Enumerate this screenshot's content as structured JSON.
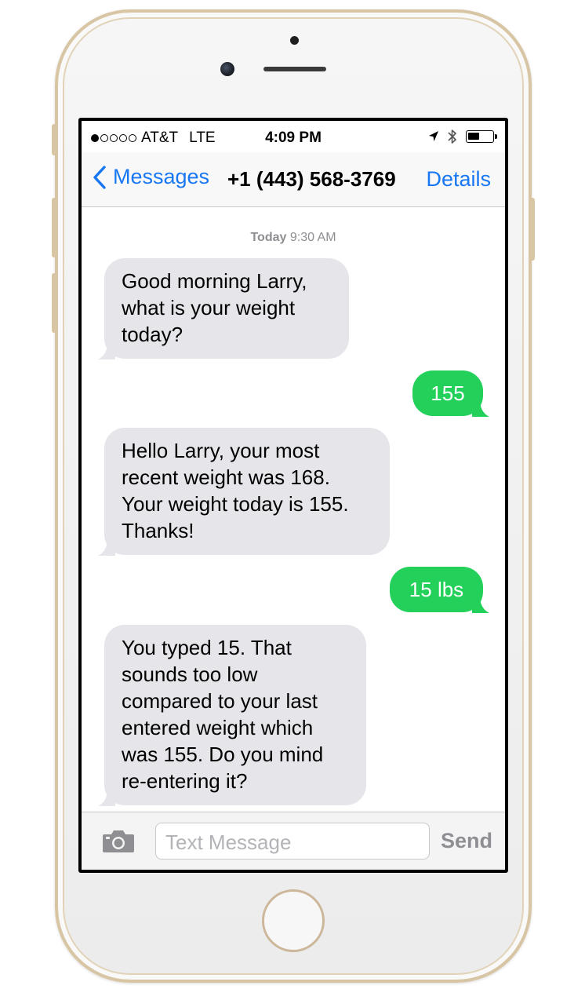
{
  "status_bar": {
    "signal_filled": 1,
    "signal_total": 5,
    "carrier": "AT&T",
    "network": "LTE",
    "time": "4:09 PM",
    "battery_level": 0.45
  },
  "nav": {
    "back_label": "Messages",
    "title": "+1 (443) 568-3769",
    "details_label": "Details"
  },
  "conversation": {
    "timestamp_day": "Today",
    "timestamp_time": "9:30 AM",
    "messages": [
      {
        "direction": "incoming",
        "lines": [
          "Good morning Larry,",
          "what is your weight",
          "today?"
        ]
      },
      {
        "direction": "outgoing",
        "lines": [
          "155"
        ]
      },
      {
        "direction": "incoming",
        "lines": [
          "Hello Larry, your most",
          "recent weight was 168.",
          "Your weight today is 155.",
          "Thanks!"
        ]
      },
      {
        "direction": "outgoing",
        "lines": [
          "15 lbs"
        ]
      },
      {
        "direction": "incoming",
        "lines": [
          "You typed 15. That",
          "sounds too low",
          "compared to your last",
          "entered weight which",
          "was 155. Do you mind",
          "re-entering it?"
        ]
      }
    ]
  },
  "input": {
    "placeholder": "Text Message",
    "send_label": "Send"
  },
  "colors": {
    "accent": "#1877f2",
    "incoming_bubble": "#e5e5ea",
    "outgoing_bubble": "#22d05a",
    "phone_trim": "#d8c5a4"
  },
  "icons": {
    "back": "chevron-left-icon",
    "location": "location-arrow-icon",
    "bluetooth": "bluetooth-icon",
    "battery": "battery-icon",
    "camera": "camera-icon"
  }
}
